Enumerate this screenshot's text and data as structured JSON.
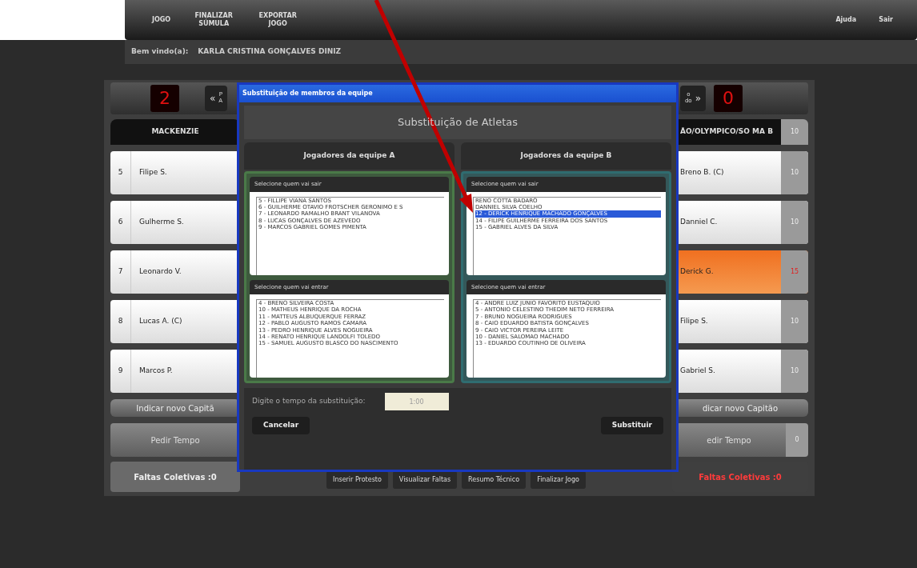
{
  "nav": {
    "items": [
      {
        "label": "JOGO"
      },
      {
        "label": "FINALIZAR SÚMULA"
      },
      {
        "label": "EXPORTAR JOGO"
      }
    ],
    "right_items": [
      {
        "label": "Ajuda"
      },
      {
        "label": "Sair"
      }
    ]
  },
  "welcome": {
    "label": "Bem vindo(a):",
    "user": "KARLA CRISTINA GONÇALVES DINIZ"
  },
  "scoreboard": {
    "team_a_score": "2",
    "prev_arrow": "«",
    "prev_label": [
      "P",
      "A"
    ],
    "next_label": [
      "o",
      "do"
    ],
    "next_arrow": "»",
    "team_b_score": "0"
  },
  "team_a": {
    "name": "MACKENZIE",
    "players": [
      {
        "number": "5",
        "name": "Filipe S."
      },
      {
        "number": "6",
        "name": "Gulherme S."
      },
      {
        "number": "7",
        "name": "Leonardo V."
      },
      {
        "number": "8",
        "name": "Lucas A. (C)"
      },
      {
        "number": "9",
        "name": "Marcos P."
      }
    ],
    "captain_button": "Indicar novo Capitã",
    "timeout_button": "Pedir Tempo",
    "fouls": "Faltas Coletivas :0"
  },
  "team_b": {
    "name": "ÃO/OLYMPICO/SO MA B",
    "header_score": "10",
    "players": [
      {
        "name": "Breno B. (C)",
        "score": "10",
        "highlighted": false
      },
      {
        "name": "Danniel C.",
        "score": "10",
        "highlighted": false
      },
      {
        "name": "Derick G.",
        "score": "15",
        "highlighted": true
      },
      {
        "name": "Filipe S.",
        "score": "10",
        "highlighted": false
      },
      {
        "name": "Gabriel S.",
        "score": "10",
        "highlighted": false
      }
    ],
    "captain_button": "dicar novo Capitão",
    "timeout_button": "edir Tempo",
    "timeout_count": "0",
    "fouls": "Faltas Coletivas :0"
  },
  "actions": [
    "Inserir Protesto",
    "Visualizar Faltas",
    "Resumo Técnico",
    "Finalizar Jogo"
  ],
  "modal": {
    "title": "Substituição de membros da equipe",
    "heading": "Substituição de Atletas",
    "teams": [
      {
        "label": "Jogadores da equipe A",
        "kind": "a",
        "out_label": "Selecione quem vai sair",
        "out": [
          {
            "text": "5 - FILLIPE VIANA SANTOS",
            "selected": false
          },
          {
            "text": "6 - GUILHERME OTAVIO FROTSCHER GERONIMO E S",
            "selected": false
          },
          {
            "text": "7 - LEONARDO RAMALHO BRANT VILANOVA",
            "selected": false
          },
          {
            "text": "8 - LUCAS GONÇALVES DE AZEVEDO",
            "selected": false
          },
          {
            "text": "9 - MARCOS GABRIEL GOMES PIMENTA",
            "selected": false
          }
        ],
        "in_label": "Selecione quem vai entrar",
        "in": [
          {
            "text": "4 - BRENO SILVEIRA COSTA",
            "selected": false
          },
          {
            "text": "10 - MATHEUS HENRIQUE DA ROCHA",
            "selected": false
          },
          {
            "text": "11 - MATTEUS ALBUQUERQUE FERRAZ",
            "selected": false
          },
          {
            "text": "12 - PABLO AUGUSTO RAMOS CAMARA",
            "selected": false
          },
          {
            "text": "13 - PEDRO HENRIQUE ALVES NOGUEIRA",
            "selected": false
          },
          {
            "text": "14 - RENATO HENRIQUE LANDOLFI TOLEDO",
            "selected": false
          },
          {
            "text": "15 - SAMUEL AUGUSTO BLASCO DO NASCIMENTO",
            "selected": false
          }
        ]
      },
      {
        "label": "Jogadores da equipe B",
        "kind": "b",
        "out_label": "Selecione quem vai sair",
        "out": [
          {
            "text": "RENO COTTA BADARÓ",
            "selected": false
          },
          {
            "text": "DANNIEL SILVA COELHO",
            "selected": false
          },
          {
            "text": "12 - DERICK HENRIQUE MACHADO GONÇALVES",
            "selected": true
          },
          {
            "text": "14 - FILIPE GUILHERME FERREIRA DOS SANTOS",
            "selected": false
          },
          {
            "text": "15 - GABRIEL ALVES DA SILVA",
            "selected": false
          }
        ],
        "in_label": "Selecione quem vai entrar",
        "in": [
          {
            "text": "4 - ANDRE LUIZ JUNIO FAVORITO EUSTAQUIO",
            "selected": false
          },
          {
            "text": "5 - ANTONIO CELESTINO THEDIM NETO FERREIRA",
            "selected": false
          },
          {
            "text": "7 - BRUNO NOGUEIRA RODRIGUES",
            "selected": false
          },
          {
            "text": "8 - CAIO EDUARDO BATISTA GONÇALVES",
            "selected": false
          },
          {
            "text": "9 - CAIO VICTOR PEREIRA LEITE",
            "selected": false
          },
          {
            "text": "10 - DANIEL SALOMAO MACHADO",
            "selected": false
          },
          {
            "text": "13 - EDUARDO COUTINHO DE OLIVEIRA",
            "selected": false
          }
        ]
      }
    ],
    "time_label": "Digite o tempo da substituição:",
    "time_value": "1:00",
    "cancel": "Cancelar",
    "submit": "Substituir"
  }
}
